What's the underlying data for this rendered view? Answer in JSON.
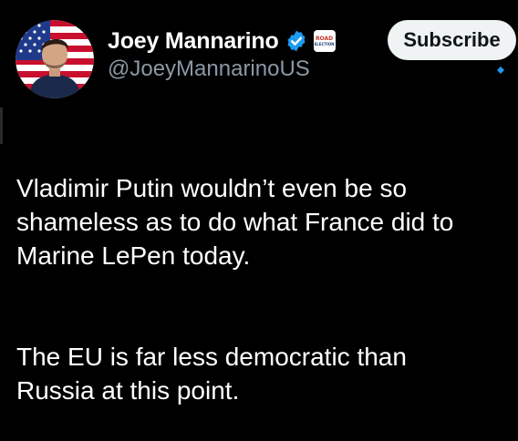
{
  "author": {
    "display_name": "Joey Mannarino",
    "handle": "@JoeyMannarinoUS",
    "verified_icon": "verified-badge-icon",
    "affiliate_badge": {
      "line1": "ROAD",
      "line2": "ELECTION"
    }
  },
  "actions": {
    "subscribe_label": "Subscribe"
  },
  "tweet": {
    "paragraphs": [
      "Vladimir Putin wouldn’t even be so\nshameless as to do what France did to\nMarine LePen today.",
      "The EU is far less democratic than\nRussia at this point."
    ]
  },
  "colors": {
    "background": "#000000",
    "text": "#ffffff",
    "secondary_text": "#8b98a5",
    "verified_blue": "#1d9bf0",
    "button_bg": "#eff3f4",
    "button_text": "#0f1419"
  }
}
